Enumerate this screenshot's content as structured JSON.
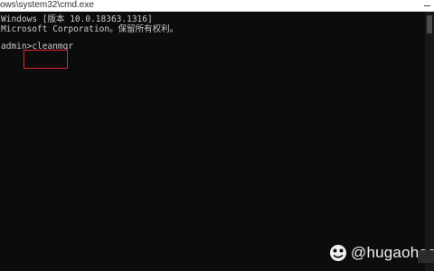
{
  "window": {
    "title": "ows\\system32\\cmd.exe"
  },
  "console": {
    "lines": [
      "Windows [版本 10.0.18363.1316]",
      "Microsoft Corporation。保留所有权利。",
      "admin>cleanmgr"
    ],
    "highlight_color": "#e0262b",
    "text_color": "#cccccc",
    "background": "#0c0c0c"
  },
  "watermark": {
    "text": "@hugaohao",
    "icon": "duitang-logo-icon"
  }
}
